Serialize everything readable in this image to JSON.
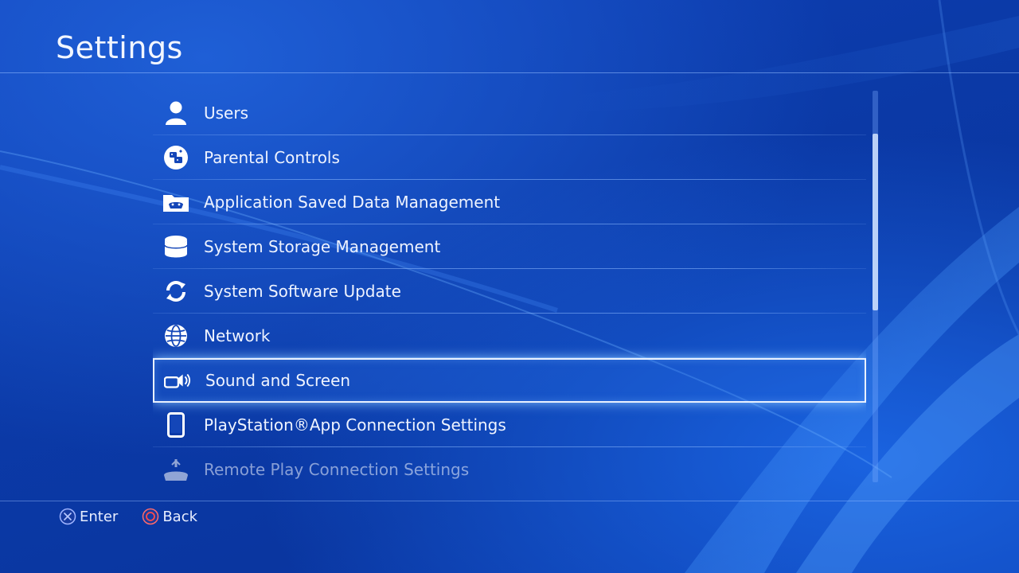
{
  "header": {
    "title": "Settings"
  },
  "menu": {
    "items": [
      {
        "label": "Users",
        "icon": "user-icon"
      },
      {
        "label": "Parental Controls",
        "icon": "parental-controls-icon"
      },
      {
        "label": "Application Saved Data Management",
        "icon": "saved-data-icon"
      },
      {
        "label": "System Storage Management",
        "icon": "storage-icon"
      },
      {
        "label": "System Software Update",
        "icon": "update-icon"
      },
      {
        "label": "Network",
        "icon": "globe-icon"
      },
      {
        "label": "Sound and Screen",
        "icon": "sound-screen-icon",
        "selected": true
      },
      {
        "label": "PlayStation®App Connection Settings",
        "icon": "phone-icon"
      },
      {
        "label": "Remote Play Connection Settings",
        "icon": "remote-play-icon"
      }
    ],
    "scroll_position": 0.2,
    "scroll_visible_fraction": 0.45
  },
  "footer": {
    "enter_label": "Enter",
    "back_label": "Back"
  },
  "colors": {
    "background": "#0b3aa8",
    "text": "#eef3ff",
    "highlight_border": "#e9f1ff",
    "cross_button": "#9fb4ff",
    "circle_button": "#ff4a4a"
  }
}
